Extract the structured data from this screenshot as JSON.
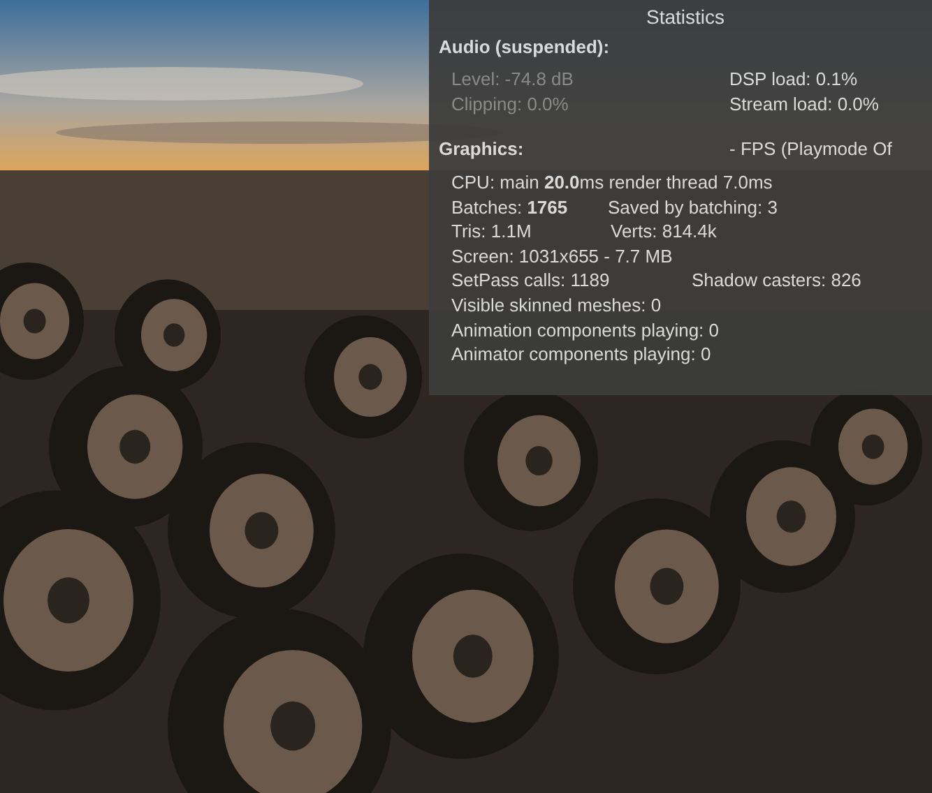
{
  "panel": {
    "title": "Statistics",
    "audio": {
      "heading": "Audio (suspended):",
      "dimmed": true,
      "rows": [
        [
          "Level: -74.8 dB",
          "DSP load: 0.1%"
        ],
        [
          "Clipping: 0.0%",
          "Stream load: 0.0%"
        ]
      ]
    },
    "graphics": {
      "heading": "Graphics:",
      "fps": "- FPS (Playmode Of",
      "rows": [
        [
          "CPU: main **20.0**ms  render thread 7.0ms"
        ],
        [
          "Batches: **1765**",
          "Saved by batching: 3"
        ],
        [
          "Tris: 1.1M",
          "Verts: 814.4k"
        ],
        [
          "Screen: 1031x655 - 7.7 MB"
        ],
        [
          "SetPass calls: 1189",
          "Shadow casters: 826"
        ],
        [
          "Visible skinned meshes: 0"
        ],
        [
          "Animation components playing: 0"
        ],
        [
          "Animator components playing: 0"
        ]
      ]
    }
  }
}
